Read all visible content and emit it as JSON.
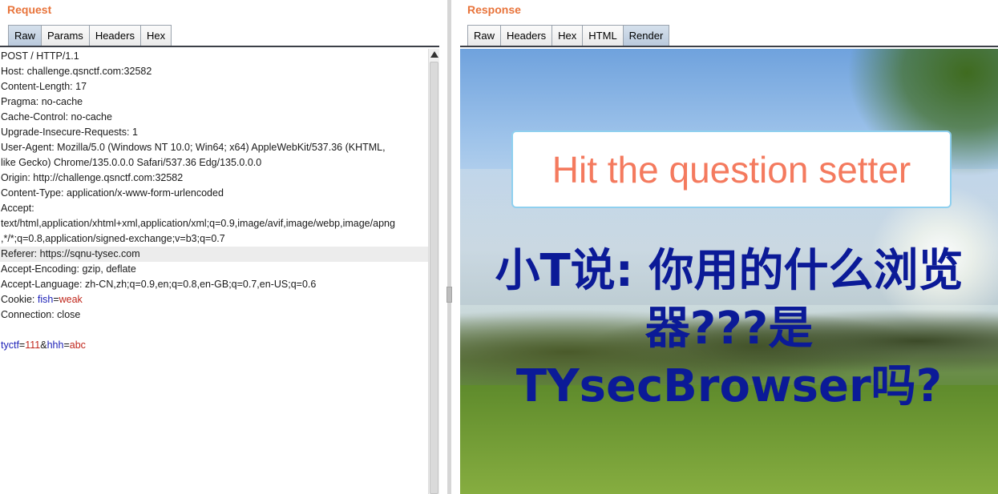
{
  "request": {
    "title": "Request",
    "tabs": [
      "Raw",
      "Params",
      "Headers",
      "Hex"
    ],
    "active_tab": "Raw",
    "lines": [
      "POST / HTTP/1.1",
      "Host: challenge.qsnctf.com:32582",
      "Content-Length: 17",
      "Pragma: no-cache",
      "Cache-Control: no-cache",
      "Upgrade-Insecure-Requests: 1",
      "User-Agent: Mozilla/5.0 (Windows NT 10.0; Win64; x64) AppleWebKit/537.36 (KHTML,",
      "like Gecko) Chrome/135.0.0.0 Safari/537.36 Edg/135.0.0.0",
      "Origin: http://challenge.qsnctf.com:32582",
      "Content-Type: application/x-www-form-urlencoded",
      "Accept:",
      "text/html,application/xhtml+xml,application/xml;q=0.9,image/avif,image/webp,image/apng",
      ",*/*;q=0.8,application/signed-exchange;v=b3;q=0.7",
      "Referer: https://sqnu-tysec.com",
      "Accept-Encoding: gzip, deflate",
      "Accept-Language: zh-CN,zh;q=0.9,en;q=0.8,en-GB;q=0.7,en-US;q=0.6"
    ],
    "cookie": {
      "prefix": "Cookie: ",
      "name": "fish",
      "eq": "=",
      "value": "weak"
    },
    "connection": "Connection: close",
    "body": {
      "k1": "tyctf",
      "v1": "111",
      "amp": "&",
      "k2": "hhh",
      "v2": "abc",
      "eq": "="
    }
  },
  "response": {
    "title": "Response",
    "tabs": [
      "Raw",
      "Headers",
      "Hex",
      "HTML",
      "Render"
    ],
    "active_tab": "Render",
    "banner": "Hit the question setter",
    "question_lines": [
      "小T说: 你用的什么浏览",
      "器???是",
      "TYsecBrowser吗?"
    ]
  }
}
